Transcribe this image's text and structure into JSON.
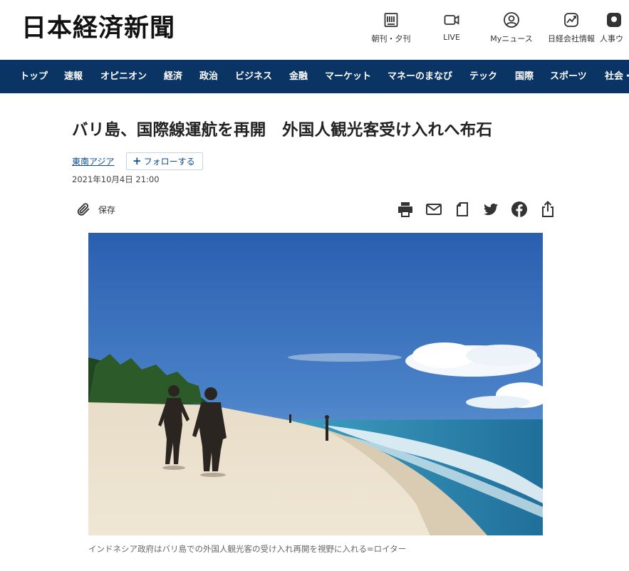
{
  "header": {
    "logo": "日本経済新聞",
    "tools": [
      {
        "label": "朝刊・夕刊",
        "icon": "newspaper-icon"
      },
      {
        "label": "LIVE",
        "icon": "video-camera-icon"
      },
      {
        "label": "Myニュース",
        "icon": "user-circle-icon"
      },
      {
        "label": "日経会社情報",
        "icon": "stock-chart-icon"
      },
      {
        "label": "人事ウ",
        "icon": "people-icon"
      }
    ]
  },
  "nav": {
    "items": [
      "トップ",
      "速報",
      "オピニオン",
      "経済",
      "政治",
      "ビジネス",
      "金融",
      "マーケット",
      "マネーのまなび",
      "テック",
      "国際",
      "スポーツ",
      "社会・"
    ]
  },
  "article": {
    "title": "バリ島、国際線運航を再開　外国人観光客受け入れへ布石",
    "topic": "東南アジア",
    "follow_label": "フォローする",
    "date": "2021年10月4日 21:00",
    "save_label": "保存",
    "share_icons": [
      "print-icon",
      "mail-icon",
      "bookmark-icon",
      "twitter-icon",
      "facebook-icon",
      "share-icon"
    ],
    "photo_caption": "インドネシア政府はバリ島での外国人観光客の受け入れ再開を視野に入れる=ロイター"
  }
}
